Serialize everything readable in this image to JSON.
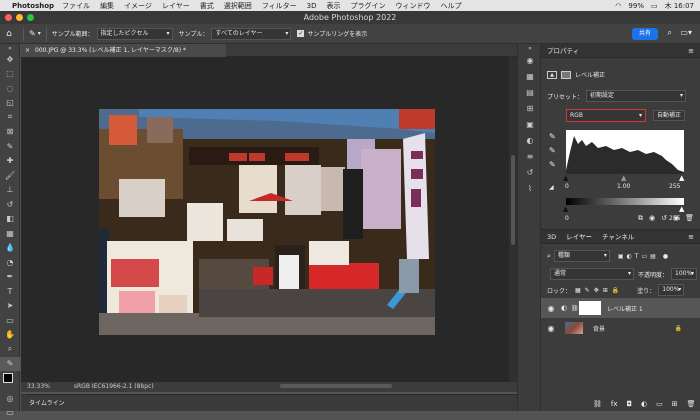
{
  "menubar": {
    "app": "Photoshop",
    "items": [
      "ファイル",
      "編集",
      "イメージ",
      "レイヤー",
      "書式",
      "選択範囲",
      "フィルター",
      "3D",
      "表示",
      "プラグイン",
      "ウィンドウ",
      "ヘルプ"
    ],
    "battery": "99%",
    "clock": "木 16:07"
  },
  "window": {
    "title": "Adobe Photoshop 2022"
  },
  "options": {
    "sample_size_label": "サンプル範囲：",
    "sample_size_value": "指定したピクセル",
    "sample_label": "サンプル：",
    "sample_value": "すべてのレイヤー",
    "show_ring": "サンプルリングを表示",
    "share": "共有"
  },
  "document": {
    "tab": "000.JPG @ 33.3% (レベル補正 1, レイヤーマスク/8) *",
    "zoom": "33.33%",
    "profile": "sRGB IEC61966-2.1 (8bpc)"
  },
  "timeline": {
    "label": "タイムライン"
  },
  "properties": {
    "tab": "プロパティ",
    "panel": "レベル補正",
    "preset_label": "プリセット：",
    "preset_value": "初期設定",
    "channel": "RGB",
    "auto": "自動補正",
    "input_black": "0",
    "input_gamma": "1.00",
    "input_white": "255",
    "output_black": "0",
    "output_white": "255"
  },
  "layers": {
    "tabs": [
      "3D",
      "レイヤー",
      "チャンネル"
    ],
    "filter": "種類",
    "blend": "通常",
    "opacity_label": "不透明度：",
    "opacity": "100%",
    "lock_label": "ロック：",
    "fill_label": "塗り：",
    "fill": "100%",
    "items": [
      {
        "name": "レベル補正 1"
      },
      {
        "name": "背景"
      }
    ]
  }
}
